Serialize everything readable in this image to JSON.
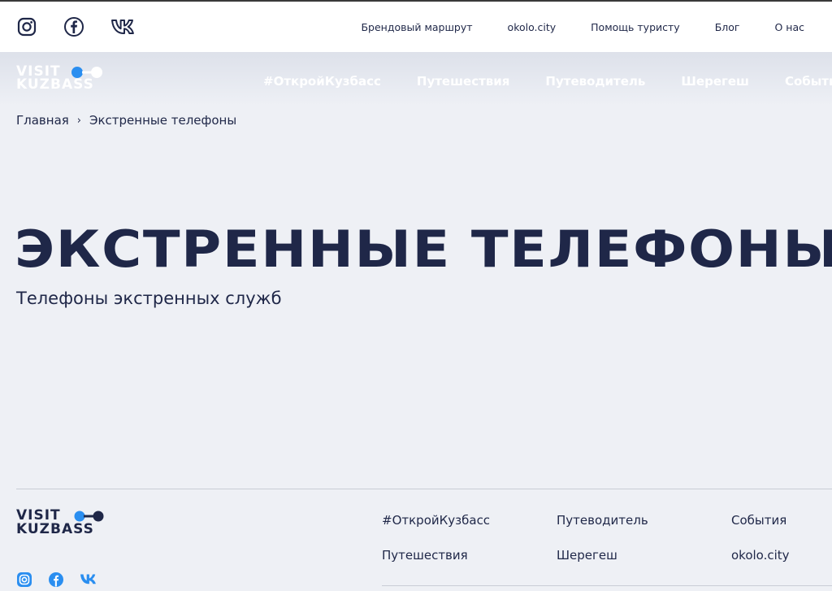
{
  "top_bar": {
    "socials": [
      {
        "icon": "instagram-icon"
      },
      {
        "icon": "facebook-icon"
      },
      {
        "icon": "vk-icon"
      }
    ],
    "links": [
      "Брендовый маршрут",
      "okolo.city",
      "Помощь туристу",
      "Блог",
      "О нас"
    ]
  },
  "main_nav": {
    "logo": {
      "line1": "VISIT",
      "line2": "KUZBASS"
    },
    "links": [
      "#ОткройКузбасс",
      "Путешествия",
      "Путеводитель",
      "Шерегеш",
      "События"
    ]
  },
  "breadcrumb": {
    "home": "Главная",
    "separator": "›",
    "current": "Экстренные телефоны"
  },
  "hero": {
    "title": "ЭКСТРЕННЫЕ ТЕЛЕФОНЫ",
    "subtitle": "Телефоны экстренных служб"
  },
  "footer": {
    "logo": {
      "line1": "VISIT",
      "line2": "KUZBASS"
    },
    "links": [
      "#ОткройКузбасс",
      "Путеводитель",
      "События",
      "Путешествия",
      "Шерегеш",
      "okolo.city"
    ],
    "socials": [
      {
        "icon": "instagram-icon"
      },
      {
        "icon": "facebook-icon"
      },
      {
        "icon": "vk-icon"
      }
    ]
  },
  "colors": {
    "background": "#eef0f5",
    "text": "#1f2748",
    "accent_blue": "#2a8ef0",
    "top_bar": "#ffffff"
  }
}
